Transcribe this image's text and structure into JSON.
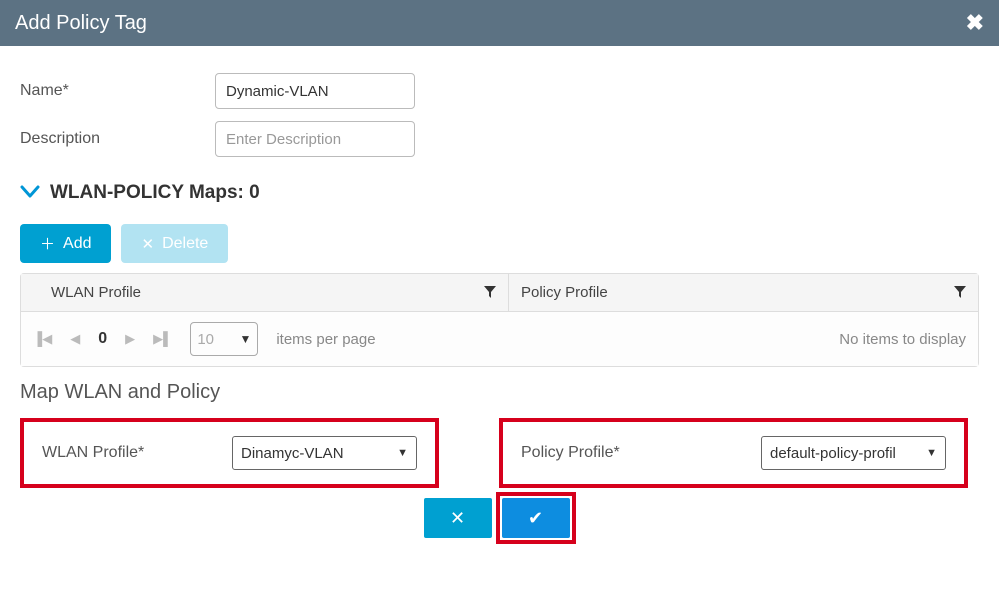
{
  "header": {
    "title": "Add Policy Tag",
    "close_icon": "✖"
  },
  "form": {
    "nameLabel": "Name*",
    "nameValue": "Dynamic-VLAN",
    "descLabel": "Description",
    "descPlaceholder": "Enter Description",
    "descValue": ""
  },
  "section": {
    "title": "WLAN-POLICY Maps:",
    "count": "0"
  },
  "buttons": {
    "addLabel": "Add",
    "deleteLabel": "Delete"
  },
  "table": {
    "col1": "WLAN Profile",
    "col2": "Policy Profile",
    "currentPage": "0",
    "pageSize": "10",
    "perPageLabel": "items per page",
    "noItems": "No items to display"
  },
  "map": {
    "title": "Map WLAN and Policy",
    "wlanLabel": "WLAN Profile*",
    "wlanValue": "Dinamyc-VLAN",
    "policyLabel": "Policy Profile*",
    "policyValue": "default-policy-profil"
  }
}
